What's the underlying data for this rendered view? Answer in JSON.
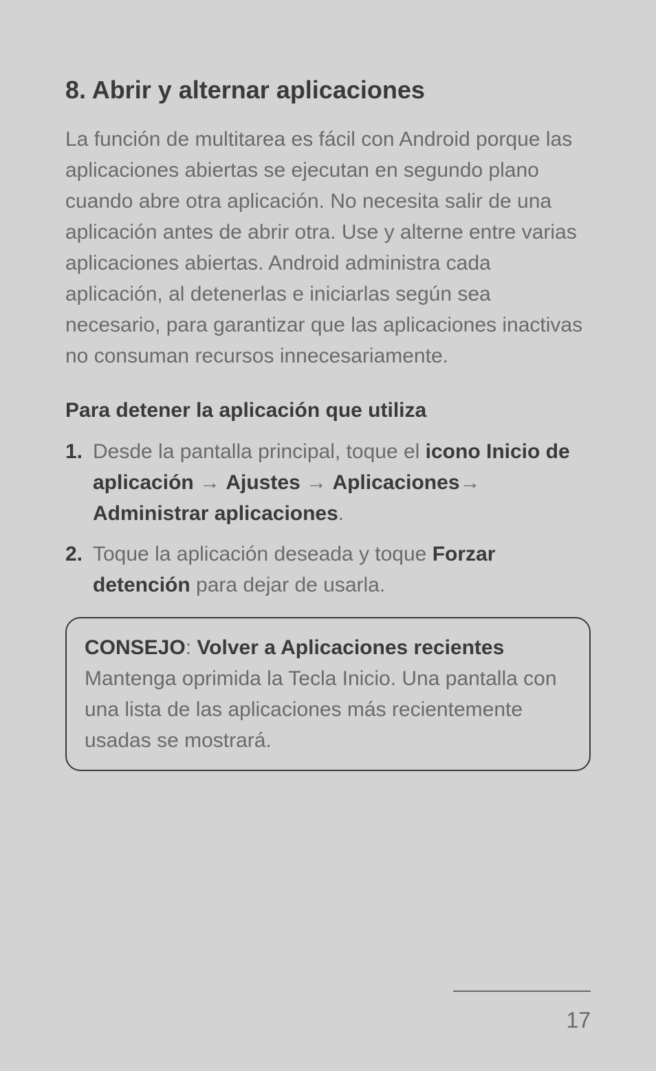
{
  "heading": "8. Abrir y alternar aplicaciones",
  "paragraph": "La función de multitarea es fácil con Android porque las aplicaciones abiertas se ejecutan en segundo plano cuando abre otra aplicación. No necesita salir de una aplicación antes de abrir otra. Use y alterne entre varias aplicaciones abiertas. Android administra cada aplicación, al detenerlas e iniciarlas según sea necesario, para garantizar que las aplicaciones inactivas no consuman recursos innecesariamente.",
  "subheading": "Para detener la aplicación que utiliza",
  "steps": {
    "num1": "1.",
    "step1_pre": " Desde la pantalla principal, toque el ",
    "step1_bold1": "icono Inicio de aplicación",
    "step1_arrow1": " → ",
    "step1_bold2": "Ajustes",
    "step1_arrow2": " → ",
    "step1_bold3": "Aplicaciones",
    "step1_arrow3": "→ ",
    "step1_bold4": "Administrar aplicaciones",
    "step1_period": ".",
    "num2": "2.",
    "step2_pre": " Toque la aplicación deseada y toque ",
    "step2_bold": "Forzar detención",
    "step2_post": " para dejar de usarla."
  },
  "tip": {
    "label": "CONSEJO",
    "colon": ": ",
    "title": "Volver a Aplicaciones recientes",
    "body": "Mantenga oprimida la Tecla Inicio. Una pantalla con una lista de las aplicaciones más recientemente usadas se mostrará."
  },
  "pageNumber": "17"
}
